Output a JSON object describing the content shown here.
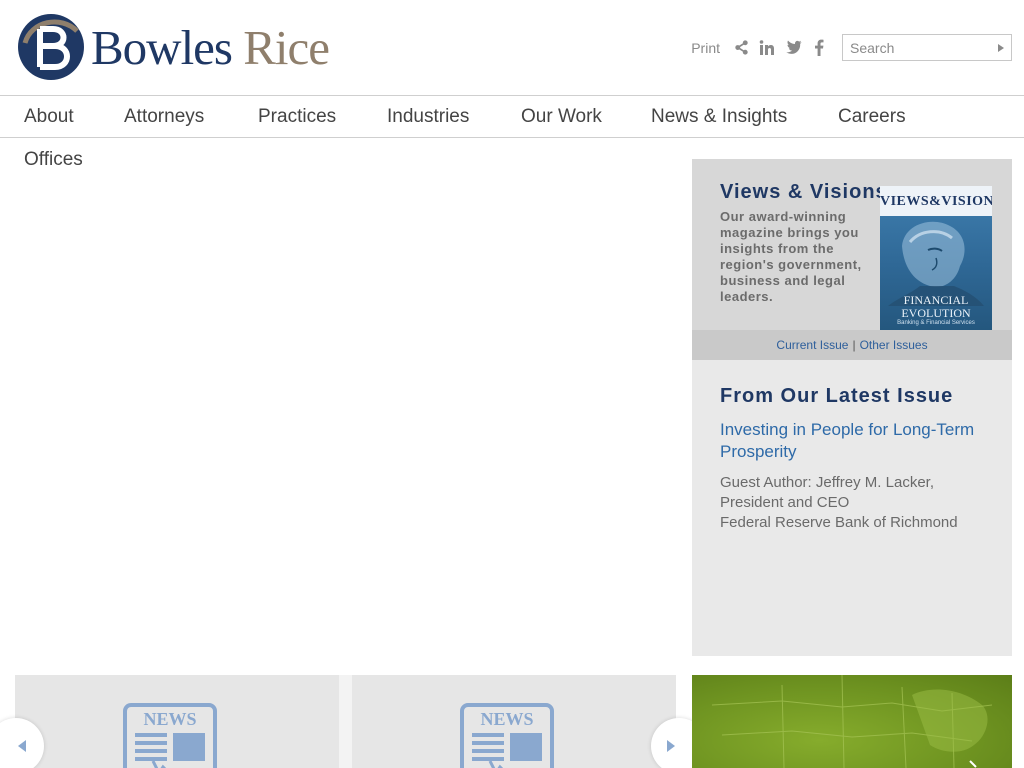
{
  "brand": {
    "name_part1": "Bowles",
    "name_part2": "Rice",
    "colors": {
      "navy": "#1f3864",
      "taupe": "#8f7f6c",
      "link": "#2e6aa8"
    }
  },
  "toolbar": {
    "print_label": "Print",
    "icons": [
      "share-icon",
      "linkedin-icon",
      "twitter-icon",
      "facebook-icon"
    ],
    "search_placeholder": "Search"
  },
  "nav": {
    "items": [
      "About",
      "Attorneys",
      "Practices",
      "Industries",
      "Our Work",
      "News & Insights",
      "Careers",
      "Offices"
    ]
  },
  "sidebar": {
    "magazine": {
      "title": "Views & Visions",
      "description": "Our award-winning magazine brings you insights from the region's government, business and legal leaders.",
      "cover_title": "VIEWS&VISIONS",
      "cover_headline": "FINANCIAL EVOLUTION",
      "cover_subtitle": "Banking & Financial Services",
      "current_issue": "Current Issue",
      "separator": "|",
      "other_issues": "Other Issues"
    },
    "latest": {
      "heading": "From Our Latest Issue",
      "article_title": "Investing in People for Long-Term Prosperity",
      "author_line1": "Guest Author: Jeffrey M. Lacker,",
      "author_line2": "President and CEO",
      "author_line3": "Federal Reserve Bank of Richmond"
    }
  },
  "cards": {
    "news_label": "NEWS"
  }
}
